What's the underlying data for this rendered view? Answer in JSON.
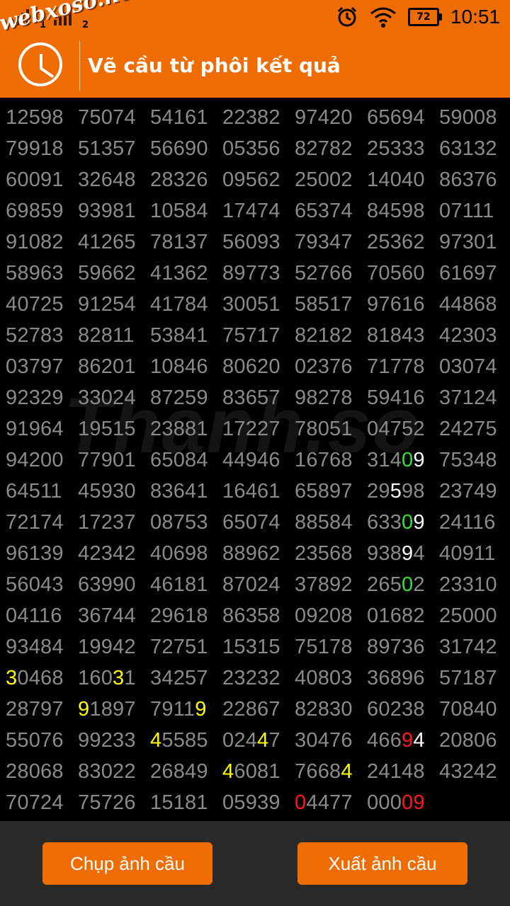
{
  "status_bar": {
    "sim1_label": "1",
    "sim2_label": "2",
    "brand_watermark": "webxoso.net",
    "battery_level": "72",
    "time": "10:51",
    "icons": [
      "signal-icon",
      "alarm-icon",
      "wifi-icon",
      "battery-icon"
    ]
  },
  "toolbar": {
    "title": "Vẽ cầu từ phôi kết quả",
    "logo_icon": "clock-logo-icon",
    "background_color": "#ef6c00"
  },
  "grid": {
    "background_watermark": "Thanh.so",
    "rows": [
      [
        "12598",
        "75074",
        "54161",
        "22382",
        "97420",
        "65694",
        "59008"
      ],
      [
        "79918",
        "51357",
        "56690",
        "05356",
        "82782",
        "25333",
        "63132"
      ],
      [
        "60091",
        "32648",
        "28326",
        "09562",
        "25002",
        "14040",
        "86376"
      ],
      [
        "69859",
        "93981",
        "10584",
        "17474",
        "65374",
        "84598",
        "07111"
      ],
      [
        "91082",
        "41265",
        "78137",
        "56093",
        "79347",
        "25362",
        "97301"
      ],
      [
        "58963",
        "59662",
        "41362",
        "89773",
        "52766",
        "70560",
        "61697"
      ],
      [
        "40725",
        "91254",
        "41784",
        "30051",
        "58517",
        "97616",
        "44868"
      ],
      [
        "52783",
        "82811",
        "53841",
        "75717",
        "82182",
        "81843",
        "42303"
      ],
      [
        "03797",
        "86201",
        "10846",
        "80620",
        "02376",
        "71778",
        "03074"
      ],
      [
        "92329",
        "33024",
        "87259",
        "83657",
        "98278",
        "59416",
        "37124"
      ],
      [
        "91964",
        "19515",
        "23881",
        "17227",
        "78051",
        "04752",
        "24275"
      ],
      [
        "94200",
        "77901",
        "65084",
        "44946",
        "16768",
        "31409",
        "75348"
      ],
      [
        "64511",
        "45930",
        "83641",
        "16461",
        "65897",
        "29598",
        "23749"
      ],
      [
        "72174",
        "17237",
        "08753",
        "65074",
        "88584",
        "63309",
        "24116"
      ],
      [
        "96139",
        "42342",
        "40698",
        "88962",
        "23568",
        "93894",
        "40911"
      ],
      [
        "56043",
        "63990",
        "46181",
        "87024",
        "37892",
        "26502",
        "23310"
      ],
      [
        "04116",
        "36744",
        "29618",
        "86358",
        "09208",
        "01682",
        "25000"
      ],
      [
        "93484",
        "19942",
        "72751",
        "15315",
        "75178",
        "89736",
        "31742"
      ],
      [
        "30468",
        "16031",
        "34257",
        "23232",
        "40803",
        "36896",
        "57187"
      ],
      [
        "28797",
        "91897",
        "79119",
        "22867",
        "82830",
        "60238",
        "70840"
      ],
      [
        "55076",
        "99233",
        "45585",
        "02447",
        "30476",
        "46694",
        "20806"
      ],
      [
        "28068",
        "83022",
        "26849",
        "46081",
        "76684",
        "24148",
        "43242"
      ],
      [
        "70724",
        "75726",
        "15181",
        "05939",
        "04477",
        "00009",
        ""
      ]
    ],
    "highlights": [
      {
        "row": 11,
        "col": 5,
        "digit": 4,
        "color": "green"
      },
      {
        "row": 11,
        "col": 5,
        "digit": 5,
        "color": "white"
      },
      {
        "row": 12,
        "col": 5,
        "digit": 3,
        "color": "white"
      },
      {
        "row": 13,
        "col": 5,
        "digit": 4,
        "color": "green"
      },
      {
        "row": 13,
        "col": 5,
        "digit": 5,
        "color": "white"
      },
      {
        "row": 14,
        "col": 5,
        "digit": 4,
        "color": "white"
      },
      {
        "row": 15,
        "col": 5,
        "digit": 4,
        "color": "green"
      },
      {
        "row": 18,
        "col": 0,
        "digit": 1,
        "color": "yellow"
      },
      {
        "row": 18,
        "col": 1,
        "digit": 4,
        "color": "yellow"
      },
      {
        "row": 19,
        "col": 1,
        "digit": 1,
        "color": "yellow"
      },
      {
        "row": 19,
        "col": 2,
        "digit": 5,
        "color": "yellow"
      },
      {
        "row": 20,
        "col": 2,
        "digit": 1,
        "color": "yellow"
      },
      {
        "row": 20,
        "col": 3,
        "digit": 4,
        "color": "yellow"
      },
      {
        "row": 20,
        "col": 5,
        "digit": 4,
        "color": "red"
      },
      {
        "row": 20,
        "col": 5,
        "digit": 5,
        "color": "white"
      },
      {
        "row": 21,
        "col": 3,
        "digit": 1,
        "color": "yellow"
      },
      {
        "row": 21,
        "col": 4,
        "digit": 5,
        "color": "yellow"
      },
      {
        "row": 22,
        "col": 4,
        "digit": 1,
        "color": "red"
      },
      {
        "row": 22,
        "col": 5,
        "digit": 4,
        "color": "red"
      },
      {
        "row": 22,
        "col": 5,
        "digit": 5,
        "color": "red"
      }
    ]
  },
  "actions": {
    "capture_label": "Chụp ảnh cầu",
    "export_label": "Xuất ảnh cầu"
  }
}
